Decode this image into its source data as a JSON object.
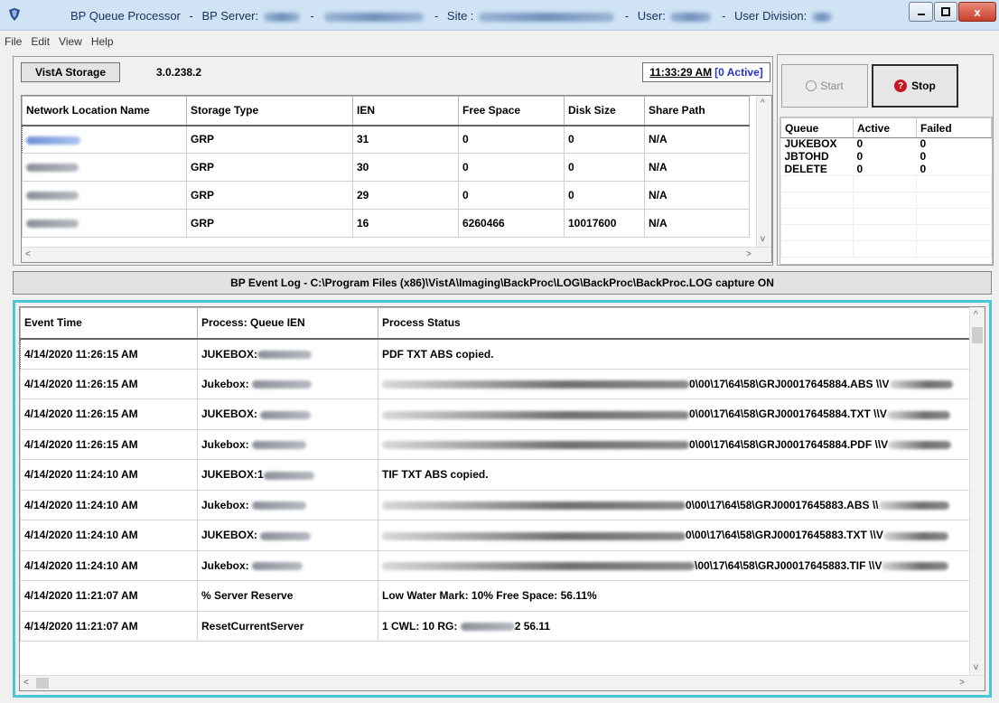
{
  "titlebar": {
    "app_name": "BP Queue Processor",
    "server_label": "BP Server:",
    "site_label": "Site :",
    "user_label": "User:",
    "division_label": "User Division:",
    "close_glyph": "x"
  },
  "menu": [
    "File",
    "Edit",
    "View",
    "Help"
  ],
  "storage": {
    "button_label": "VistA Storage",
    "version": "3.0.238.2",
    "clock_time": "11:33:29 AM",
    "clock_active": "[0 Active]",
    "columns": [
      "Network Location Name",
      "Storage Type",
      "IEN",
      "Free Space",
      "Disk Size",
      "Share Path"
    ],
    "rows": [
      {
        "type": "GRP",
        "ien": "31",
        "free": "0",
        "disk": "0",
        "share": "N/A"
      },
      {
        "type": "GRP",
        "ien": "30",
        "free": "0",
        "disk": "0",
        "share": "N/A"
      },
      {
        "type": "GRP",
        "ien": "29",
        "free": "0",
        "disk": "0",
        "share": "N/A"
      },
      {
        "type": "GRP",
        "ien": "16",
        "free": "6260466",
        "disk": "10017600",
        "share": "N/A"
      }
    ]
  },
  "controls": {
    "start_label": "Start",
    "stop_label": "Stop",
    "stop_glyph": "?"
  },
  "queues": {
    "columns": [
      "Queue",
      "Active",
      "Failed"
    ],
    "rows": [
      {
        "queue": "JUKEBOX",
        "active": "0",
        "failed": "0"
      },
      {
        "queue": "JBTOHD",
        "active": "0",
        "failed": "0"
      },
      {
        "queue": "DELETE",
        "active": "0",
        "failed": "0"
      }
    ]
  },
  "event_log": {
    "header": "BP Event Log - C:\\Program Files (x86)\\VistA\\Imaging\\BackProc\\LOG\\BackProc\\BackProc.LOG capture ON",
    "columns": [
      "Event Time",
      "Process: Queue IEN",
      "Process Status"
    ],
    "rows": [
      {
        "time": "4/14/2020 11:26:15 AM",
        "process": "JUKEBOX:",
        "status": "PDF TXT ABS copied."
      },
      {
        "time": "4/14/2020 11:26:15 AM",
        "process": "Jukebox:",
        "status": "0\\00\\17\\64\\58\\GRJ00017645884.ABS \\\\V"
      },
      {
        "time": "4/14/2020 11:26:15 AM",
        "process": "JUKEBOX:",
        "status": "0\\00\\17\\64\\58\\GRJ00017645884.TXT \\\\V"
      },
      {
        "time": "4/14/2020 11:26:15 AM",
        "process": "Jukebox:",
        "status": "0\\00\\17\\64\\58\\GRJ00017645884.PDF \\\\V"
      },
      {
        "time": "4/14/2020 11:24:10 AM",
        "process": "JUKEBOX:1",
        "status": "TIF TXT ABS copied."
      },
      {
        "time": "4/14/2020 11:24:10 AM",
        "process": "Jukebox:",
        "status": "0\\00\\17\\64\\58\\GRJ00017645883.ABS \\\\"
      },
      {
        "time": "4/14/2020 11:24:10 AM",
        "process": "JUKEBOX:",
        "status": "0\\00\\17\\64\\58\\GRJ00017645883.TXT \\\\V"
      },
      {
        "time": "4/14/2020 11:24:10 AM",
        "process": "Jukebox:",
        "status": "\\00\\17\\64\\58\\GRJ00017645883.TIF \\\\V"
      },
      {
        "time": "4/14/2020 11:21:07 AM",
        "process": "% Server Reserve",
        "status": "Low Water Mark: 10%   Free Space: 56.11%"
      },
      {
        "time": "4/14/2020 11:21:07 AM",
        "process": "ResetCurrentServer",
        "status": "1 CWL: 10 RG:",
        "status_tail": "2 56.11"
      }
    ]
  }
}
